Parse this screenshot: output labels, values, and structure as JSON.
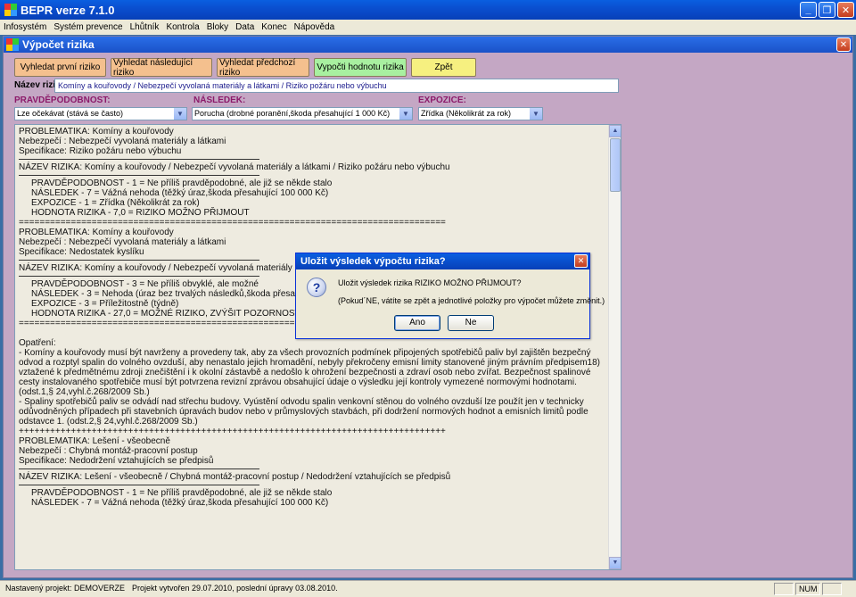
{
  "app": {
    "title": "BEPR verze 7.1.0",
    "minimize": "_",
    "restore": "❐",
    "close": "✕"
  },
  "menu": [
    "Infosystém",
    "Systém prevence",
    "Lhůtník",
    "Kontrola",
    "Bloky",
    "Data",
    "Konec",
    "Nápověda"
  ],
  "child_window": {
    "title": "Výpočet rizika",
    "close": "✕"
  },
  "toolbar": {
    "first": "Vyhledat první riziko",
    "next": "Vyhledat následující riziko",
    "prev": "Vyhledat předchozí riziko",
    "compute": "Vypočti hodnotu rizika",
    "back": "Zpět"
  },
  "risk_name": {
    "label": "Název rizika",
    "value": "Komíny a kouřovody / Nebezpečí vyvolaná materiály a látkami / Riziko požáru nebo výbuchu"
  },
  "fields": {
    "probability_label": "PRAVDĚPODOBNOST:",
    "probability_value": "Lze očekávat (stává se často)",
    "consequence_label": "NÁSLEDEK:",
    "consequence_value": "Porucha (drobné poranění,škoda přesahující 1 000 Kč)",
    "exposure_label": "EXPOZICE:",
    "exposure_value": "Zřídka (Několikrát za rok)"
  },
  "text": {
    "b1_l1": "PROBLEMATIKA: Komíny a kouřovody",
    "b1_l2": "Nebezpečí : Nebezpečí vyvolaná materiály a látkami",
    "b1_l3": "Specifikace: Riziko požáru nebo výbuchu",
    "b1_name_hl": "NÁZEV RIZIKA",
    "b1_name_rest": ": Komíny a kouřovody / Nebezpečí vyvolaná materiály a látkami / Riziko požáru nebo výbuchu",
    "b1_p": "PRAVDĚPODOBNOST - 1 = Ne příliš pravděpodobné, ale již se někde stalo",
    "b1_n": "NÁSLEDEK - 7 = Vážná nehoda (těžký úraz,škoda přesahující 100 000 Kč)",
    "b1_e": "EXPOZICE - 1 = Zřídka (Několikrát za rok)",
    "b1_h": "HODNOTA RIZIKA -    7,0 = RIZIKO MOŽNO PŘIJMOUT",
    "sep_eq": "==================================================================================",
    "b2_l1": "PROBLEMATIKA: Komíny a kouřovody",
    "b2_l2": "Nebezpečí : Nebezpečí vyvolaná materiály a látkami",
    "b2_l3": "Specifikace: Nedostatek kyslíku",
    "b2_name": "NÁZEV RIZIKA: Komíny a kouřovody / Nebezpečí vyvolaná materiály",
    "b2_p": "PRAVDĚPODOBNOST - 3 = Ne příliš obvyklé, ale možné",
    "b2_n": "NÁSLEDEK - 3 = Nehoda (úraz bez trvalých následků,škoda přesah",
    "b2_e": "EXPOZICE - 3 = Příležitostně (týdně)",
    "b2_h": "HODNOTA RIZIKA -   27,0 = MOŽNÉ RIZIKO, ZVÝŠIT POZORNOST",
    "op_title": "Opatření:",
    "op_1": "- Komíny a kouřovody musí být navrženy a provedeny tak, aby za všech provozních podmínek připojených spotřebičů paliv byl zajištěn bezpečný",
    "op_2": "odvod a rozptyl spalin do volného ovzduší, aby nenastalo jejich hromadění, nebyly překročeny emisní limity stanovené jiným právním předpisem18)",
    "op_3": "vztažené k předmětnému zdroji znečištění i k okolní zástavbě a nedošlo k ohrožení bezpečnosti a zdraví osob nebo zvířat. Bezpečnost spalinové",
    "op_4": "cesty instalovaného spotřebiče musí být potvrzena revizní zprávou obsahující údaje o výsledku její kontroly vymezené normovými hodnotami.",
    "op_5": "(odst.1,§ 24,vyhl.č.268/2009 Sb.)",
    "op_6": "- Spaliny spotřebičů paliv se odvádí nad střechu budovy. Vyústění odvodu spalin venkovní stěnou do volného ovzduší lze použít jen v technicky",
    "op_7": "odůvodněných případech při stavebních úpravách budov nebo v průmyslových stavbách, při dodržení normových hodnot a emisních limitů podle",
    "op_8": "odstavce 1. (odst.2,§ 24,vyhl.č.268/2009 Sb.)",
    "sep_plus": "++++++++++++++++++++++++++++++++++++++++++++++++++++++++++++++++++++++++++++++++++",
    "b3_l1": "PROBLEMATIKA: Lešení - všeobecně",
    "b3_l2": "Nebezpečí : Chybná montáž-pracovní postup",
    "b3_l3": "Specifikace: Nedodržení vztahujících se předpisů",
    "b3_name": "NÁZEV RIZIKA: Lešení - všeobecně / Chybná montáž-pracovní postup / Nedodržení vztahujících se předpisů",
    "b3_p": "PRAVDĚPODOBNOST - 1 = Ne příliš pravděpodobné, ale již se někde stalo",
    "b3_n": "NÁSLEDEK - 7 = Vážná nehoda (těžký úraz,škoda přesahující 100 000 Kč)"
  },
  "dialog": {
    "title": "Uložit výsledek výpočtu rizika?",
    "close": "✕",
    "message": "Uložit výsledek rizika RIZIKO MOŽNO PŘIJMOUT?",
    "note": "(Pokud´NE, vátíte se zpět a jednotlivé položky pro výpočet můžete změnit.)",
    "yes": "Ano",
    "no": "Ne"
  },
  "status": {
    "project": "Nastavený projekt: DEMOVERZE",
    "created": "Projekt vytvořen 29.07.2010, poslední úpravy 03.08.2010.",
    "num": "NUM"
  },
  "colors": {
    "window_bg": "#c4a7c4",
    "btn_orange": "#f4c08e",
    "btn_green": "#a8f0a0",
    "btn_yellow": "#f6f080",
    "highlight": "#316ac5"
  }
}
